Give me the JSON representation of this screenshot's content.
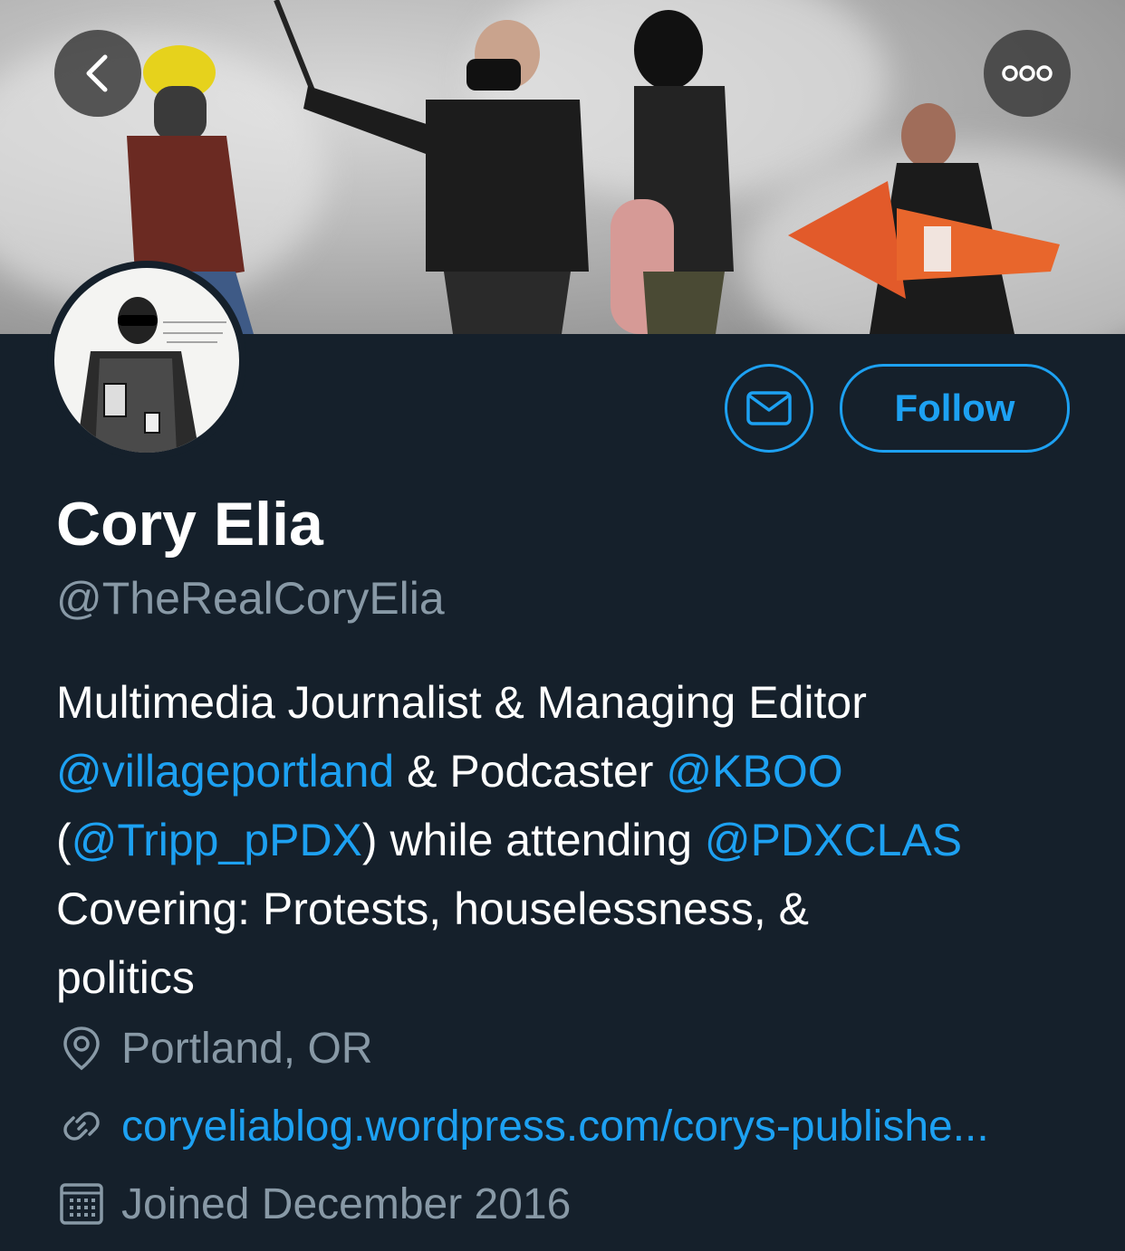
{
  "banner": {
    "alt": "",
    "back_icon": "chevron-left-icon",
    "more_icon": "more-horizontal-icon"
  },
  "actions": {
    "message_icon": "envelope-icon",
    "follow_label": "Follow"
  },
  "profile": {
    "name": "Cory Elia",
    "handle": "@TheRealCoryElia",
    "bio": {
      "line1": "Multimedia Journalist & Managing Editor",
      "line2_mention1": "@villageportland",
      "line2_text": " & Podcaster ",
      "line2_mention2": "@KBOO",
      "line3_open": "(",
      "line3_mention1": "@Tripp_pPDX",
      "line3_text": ") while attending ",
      "line3_mention2": "@PDXCLAS",
      "line4": "Covering: Protests, houselessness, &",
      "line5": "politics"
    },
    "location": "Portland, OR",
    "website": "coryeliablog.wordpress.com/corys-publishe...",
    "joined": "Joined December 2016"
  },
  "colors": {
    "background": "#15202b",
    "accent": "#1da1f2",
    "secondary_text": "#8899a6",
    "primary_text": "#ffffff"
  }
}
